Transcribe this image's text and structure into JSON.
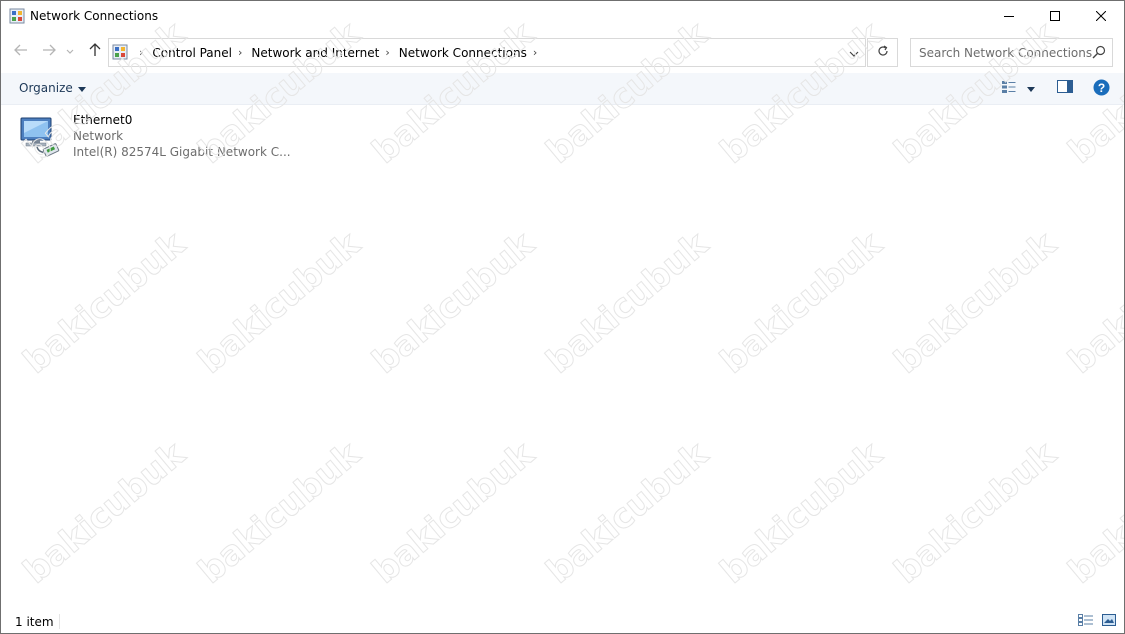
{
  "window": {
    "title": "Network Connections",
    "icon": "network-connections-icon"
  },
  "title_buttons": {
    "minimize": "minimize-icon",
    "maximize": "maximize-icon",
    "close": "close-icon"
  },
  "navigation": {
    "back": "back-arrow-icon",
    "forward": "forward-arrow-icon",
    "recent": "chevron-down-icon",
    "up": "up-arrow-icon",
    "breadcrumb": [
      "Control Panel",
      "Network and Internet",
      "Network Connections"
    ],
    "refresh": "refresh-icon"
  },
  "search": {
    "placeholder": "Search Network Connections"
  },
  "commandbar": {
    "organize_label": "Organize",
    "view_options": "view-options-icon",
    "preview_pane": "preview-pane-icon",
    "help": "help-icon",
    "help_color": "#1a6dbb"
  },
  "items": [
    {
      "name": "Ethernet0",
      "status": "Network",
      "device": "Intel(R) 82574L Gigabit Network C..."
    }
  ],
  "statusbar": {
    "count_text": "1 item"
  },
  "watermark": {
    "text": "bakicubuk"
  }
}
